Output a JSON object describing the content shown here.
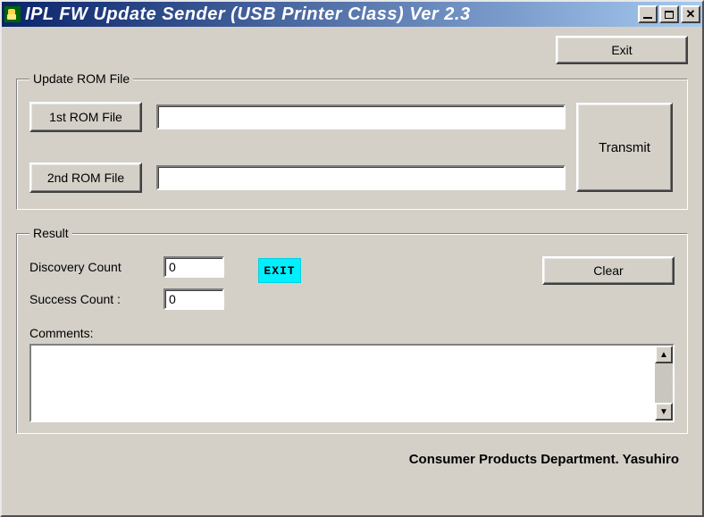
{
  "title": "IPL FW Update Sender (USB Printer Class)  Ver 2.3",
  "buttons": {
    "exit": "Exit",
    "transmit": "Transmit",
    "clear": "Clear",
    "rom1": "1st ROM File",
    "rom2": "2nd ROM File"
  },
  "groups": {
    "update": "Update ROM File",
    "result": "Result"
  },
  "fields": {
    "rom1_value": "",
    "rom2_value": "",
    "discovery_label": "Discovery Count",
    "discovery_value": "0",
    "success_label": "Success Count :",
    "success_value": "0",
    "comments_label": "Comments:",
    "comments_value": ""
  },
  "badge": {
    "exit_text": "EXIT",
    "bg": "#00f0ff"
  },
  "footer": "Consumer Products Department. Yasuhiro"
}
